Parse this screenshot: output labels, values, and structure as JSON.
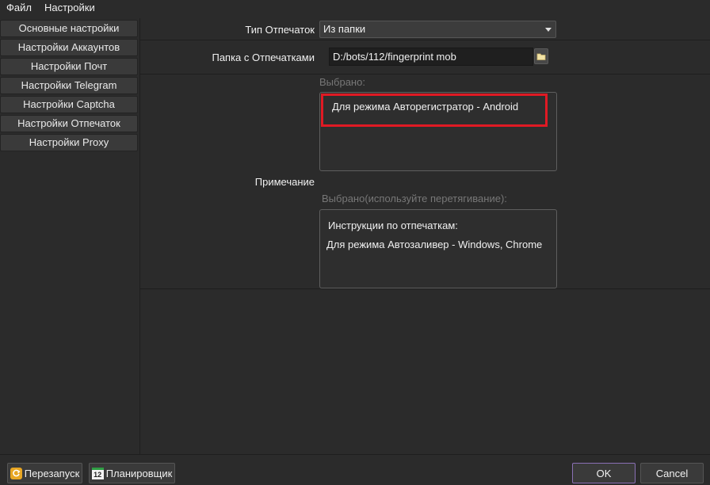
{
  "menu": {
    "file": "Файл",
    "settings": "Настройки"
  },
  "sidebar": {
    "items": [
      {
        "label": "Основные настройки"
      },
      {
        "label": "Настройки Аккаунтов"
      },
      {
        "label": "Настройки Почт"
      },
      {
        "label": "Настройки Telegram"
      },
      {
        "label": "Настройки Captcha"
      },
      {
        "label": "Настройки Отпечаток"
      },
      {
        "label": "Настройки Proxy"
      }
    ]
  },
  "form": {
    "type_label": "Тип Отпечаток",
    "type_value": "Из папки",
    "folder_label": "Папка с Отпечатками",
    "folder_value": "D:/bots/112/fingerprint mob",
    "note_label": "Примечание",
    "selected_hint": "Выбрано:",
    "selected_text": "Для режима Авторегистратор - Android",
    "selected2_hint": "Выбрано(используйте перетягивание):",
    "instructions_title": "Инструкции по отпечаткам:",
    "instructions_text": "Для режима Автозаливер - Windows, Chrome"
  },
  "bottom": {
    "restart": "Перезапуск",
    "scheduler": "Планировщик",
    "scheduler_icon_text": "12",
    "ok": "OK",
    "cancel": "Cancel"
  },
  "colors": {
    "highlight": "#e01a24",
    "background": "#2b2b2b"
  }
}
